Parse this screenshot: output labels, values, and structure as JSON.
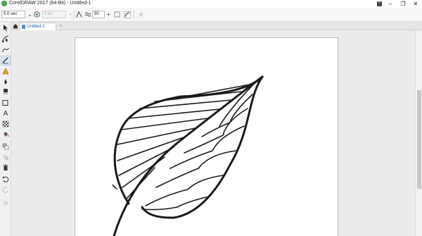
{
  "window": {
    "title": "CorelDRAW 2017 (64-Bit) - Untitled-1",
    "help_label": "?",
    "minimize": "–",
    "restore": "❐",
    "close": "✕"
  },
  "propbar": {
    "duration_value": "5.0 sec",
    "stroke_width_value": "5 px",
    "smoothing_value": "50"
  },
  "tabs": {
    "document_tab": "Untitled-1",
    "add_tab": "+"
  },
  "icons": {
    "app": "coreldraw-logo-icon",
    "pick": "pick-arrow-icon",
    "shape": "shape-edit-icon",
    "freehand": "freehand-icon",
    "artistic_media": "artistic-media-icon",
    "smart_fill": "smart-fill-icon",
    "pen": "pen-icon",
    "eraser": "eraser-icon",
    "rectangle": "rectangle-icon",
    "text": "text-icon",
    "pattern": "checker-icon",
    "fill": "paint-bucket-icon",
    "copy_props": "copy-properties-icon",
    "transparency": "transparency-icon",
    "delete": "trash-icon",
    "undo": "undo-icon",
    "redo": "redo-icon",
    "add": "add-icon"
  },
  "colors": {
    "accent": "#2160a8",
    "stroke": "#1a1a1a"
  }
}
